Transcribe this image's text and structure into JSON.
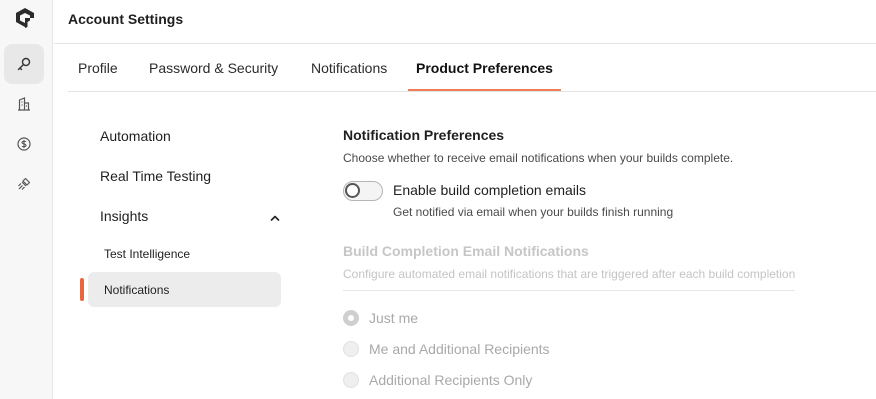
{
  "header": {
    "title": "Account Settings"
  },
  "tabs": [
    {
      "label": "Profile"
    },
    {
      "label": "Password & Security"
    },
    {
      "label": "Notifications"
    },
    {
      "label": "Product Preferences",
      "active": true
    }
  ],
  "rail": {
    "icons": [
      "logo-icon",
      "key-icon",
      "building-icon",
      "dollar-icon",
      "integration-icon"
    ],
    "active": "key-icon"
  },
  "sidenav": {
    "items": [
      {
        "label": "Automation"
      },
      {
        "label": "Real Time Testing"
      },
      {
        "label": "Insights",
        "expanded": true
      }
    ],
    "subitems": [
      {
        "label": "Test Intelligence"
      },
      {
        "label": "Notifications",
        "selected": true
      }
    ]
  },
  "content": {
    "notif_title": "Notification Preferences",
    "notif_desc": "Choose whether to receive email notifications when your builds complete.",
    "toggle": {
      "label": "Enable build completion emails",
      "sub": "Get notified via email when your builds finish running",
      "checked": false
    },
    "build_title": "Build Completion Email Notifications",
    "build_desc": "Configure automated email notifications that are triggered after each build completion",
    "radios": [
      {
        "label": "Just me",
        "checked": true
      },
      {
        "label": "Me and Additional Recipients",
        "checked": false
      },
      {
        "label": "Additional Recipients Only",
        "checked": false
      }
    ]
  },
  "colors": {
    "accent": "#f07c5a",
    "selected_bar": "#e8653d",
    "disabled_text": "#c6c6c6"
  }
}
